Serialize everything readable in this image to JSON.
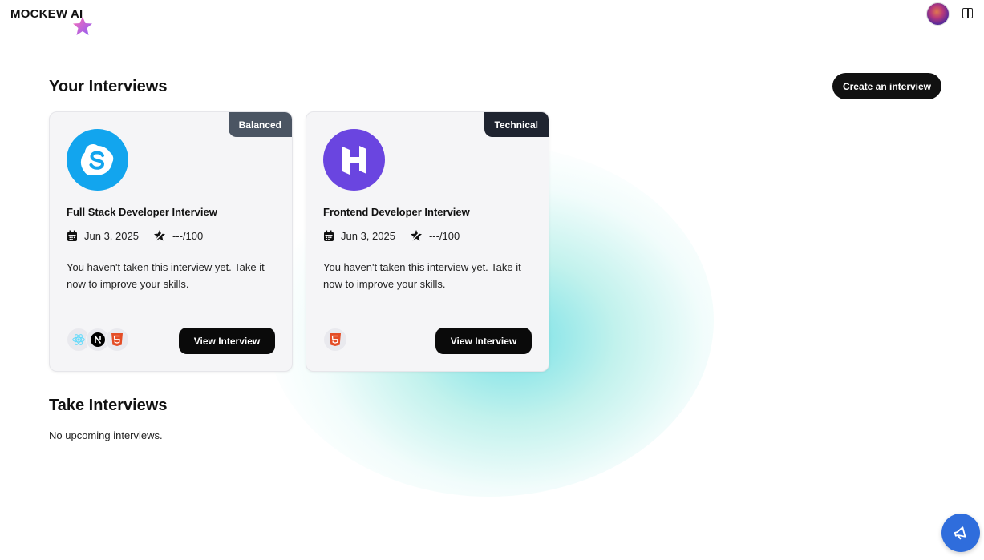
{
  "app": {
    "logo_text": "MOCKEW AI"
  },
  "header": {
    "avatar_icon": "user-avatar",
    "panel_icon": "panel-toggle-icon"
  },
  "your_interviews": {
    "title": "Your Interviews",
    "create_button": "Create an interview",
    "cards": [
      {
        "badge": "Balanced",
        "badge_color": "#4b5563",
        "logo_icon": "skype-logo-icon",
        "logo_color": "#12a5ee",
        "title": "Full Stack Developer Interview",
        "date": "Jun 3, 2025",
        "score": "---/100",
        "description": "You haven't taken this interview yet. Take it now to improve your skills.",
        "tech_icons": [
          "react-icon",
          "nextjs-icon",
          "html5-icon"
        ],
        "button": "View Interview"
      },
      {
        "badge": "Technical",
        "badge_color": "#1f2430",
        "logo_icon": "hostinger-logo-icon",
        "logo_color": "#6a45e0",
        "title": "Frontend Developer Interview",
        "date": "Jun 3, 2025",
        "score": "---/100",
        "description": "You haven't taken this interview yet. Take it now to improve your skills.",
        "tech_icons": [
          "html5-icon"
        ],
        "button": "View Interview"
      }
    ]
  },
  "take_interviews": {
    "title": "Take Interviews",
    "empty_text": "No upcoming interviews."
  },
  "feedback_button": {
    "icon": "megaphone-icon",
    "color": "#2f6ddc"
  }
}
